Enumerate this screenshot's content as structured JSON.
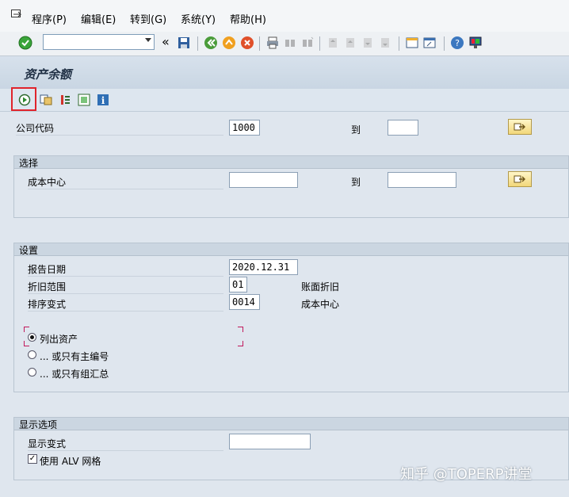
{
  "menu": {
    "items": [
      {
        "label": "程序(P)"
      },
      {
        "label": "编辑(E)"
      },
      {
        "label": "转到(G)"
      },
      {
        "label": "系统(Y)"
      },
      {
        "label": "帮助(H)"
      }
    ]
  },
  "toolbar": {
    "command_field_value": "",
    "back_chevrons": "«"
  },
  "title": "资产余额",
  "selection": {
    "company_code_label": "公司代码",
    "company_code_value": "1000",
    "to_label": "到",
    "company_code_to_value": ""
  },
  "group_selection": {
    "title": "选择",
    "cost_center_label": "成本中心",
    "cost_center_value": "",
    "to_label": "到",
    "cost_center_to_value": ""
  },
  "group_settings": {
    "title": "设置",
    "report_date_label": "报告日期",
    "report_date_value": "2020.12.31",
    "depr_area_label": "折旧范围",
    "depr_area_value": "01",
    "depr_area_desc": "账面折旧",
    "sort_variant_label": "排序变式",
    "sort_variant_value": "0014",
    "sort_variant_desc": "成本中心",
    "radios": [
      {
        "label": "列出资产",
        "selected": true
      },
      {
        "label": "... 或只有主编号",
        "selected": false
      },
      {
        "label": "... 或只有组汇总",
        "selected": false
      }
    ]
  },
  "group_display": {
    "title": "显示选项",
    "display_variant_label": "显示变式",
    "display_variant_value": "",
    "alv_label": "使用 ALV 网格",
    "alv_checked": true
  },
  "watermark": "知乎 @TOPERP讲堂"
}
